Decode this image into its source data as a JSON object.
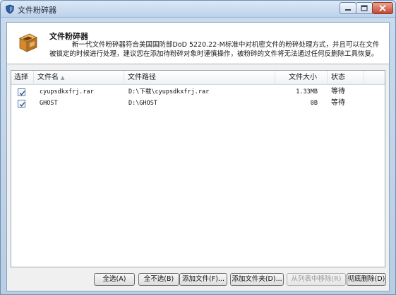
{
  "window": {
    "title": "文件粉碎器",
    "icon": "shield-icon",
    "controls": [
      "minimize-icon",
      "maximize-icon",
      "close-icon"
    ]
  },
  "header": {
    "title": "文件粉碎器",
    "description": "新一代文件粉碎器符合美国国防部DoD 5220.22-M标准中对机密文件的粉碎处理方式，并且可以在文件被锁定的时候进行处理，建议您在添加待粉碎对象时谨慎操作，被粉碎的文件将无法通过任何反删除工具恢复。",
    "icon": "shredder-box-icon"
  },
  "table": {
    "columns": [
      "选择",
      "文件名",
      "文件路径",
      "文件大小",
      "状态"
    ],
    "rows": [
      {
        "checked": true,
        "name": "cyupsdkxfrj.rar",
        "path": "D:\\下载\\cyupsdkxfrj.rar",
        "size": "1.33MB",
        "status": "等待"
      },
      {
        "checked": true,
        "name": "GHOST",
        "path": "D:\\GHOST",
        "size": "0B",
        "status": "等待"
      }
    ]
  },
  "buttons": {
    "select_all": "全选(A)",
    "select_none": "全不选(B)",
    "add_file": "添加文件(F)...",
    "add_folder": "添加文件夹(D)...",
    "remove_from_list": "从列表中移除(R)",
    "shred": "彻底删除(D)"
  },
  "colors": {
    "window_frame": "#b9cde3",
    "header_bg": "#ffffff",
    "panel_bg": "#f0f0f0",
    "checkbox_border": "#5a7ca8"
  }
}
